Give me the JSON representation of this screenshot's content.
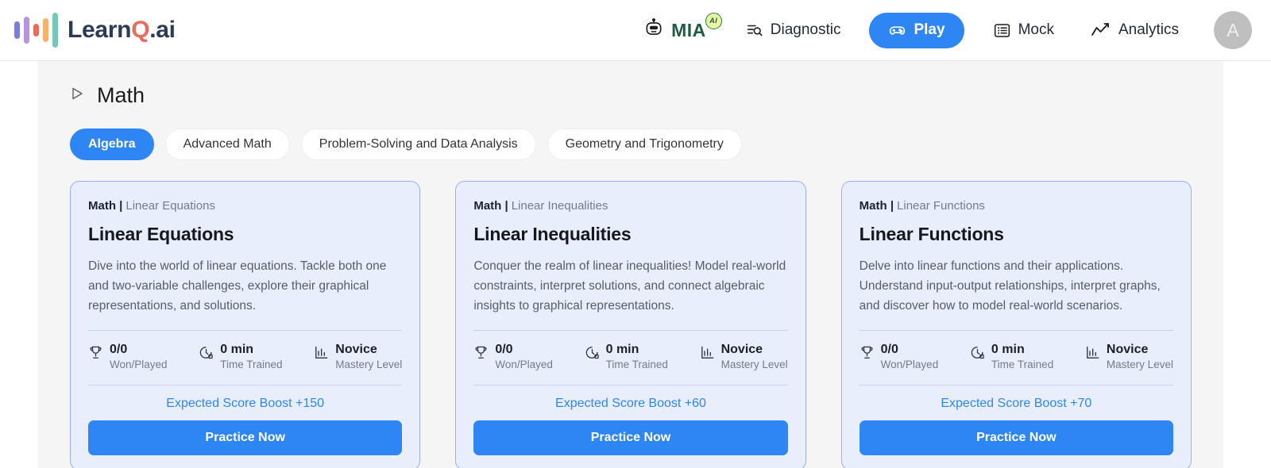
{
  "brand": {
    "name_prefix": "Learn",
    "name_q": "Q",
    "name_suffix": ".ai"
  },
  "nav": {
    "mia": {
      "label": "MIA",
      "badge": "AI",
      "icon": "robot-icon"
    },
    "items": [
      {
        "label": "Diagnostic",
        "icon": "search-list-icon",
        "active": false
      },
      {
        "label": "Play",
        "icon": "gamepad-icon",
        "active": true
      },
      {
        "label": "Mock",
        "icon": "list-icon",
        "active": false
      },
      {
        "label": "Analytics",
        "icon": "trendline-icon",
        "active": false
      }
    ],
    "avatar": {
      "initial": "A"
    }
  },
  "section": {
    "title": "Math",
    "expand_icon": "play-triangle-icon"
  },
  "tabs": [
    {
      "label": "Algebra",
      "active": true
    },
    {
      "label": "Advanced Math",
      "active": false
    },
    {
      "label": "Problem-Solving and Data Analysis",
      "active": false
    },
    {
      "label": "Geometry and Trigonometry",
      "active": false
    }
  ],
  "stat_labels": {
    "won_played": "Won/Played",
    "time_trained": "Time Trained",
    "mastery_level": "Mastery Level"
  },
  "cards": [
    {
      "subject": "Math |",
      "topic": "Linear Equations",
      "title": "Linear Equations",
      "description": "Dive into the world of linear equations. Tackle both one and two-variable challenges, explore their graphical representations, and solutions.",
      "won_played": "0/0",
      "time_trained": "0 min",
      "mastery_level": "Novice",
      "boost": "Expected Score Boost +150",
      "cta": "Practice Now"
    },
    {
      "subject": "Math |",
      "topic": "Linear Inequalities",
      "title": "Linear Inequalities",
      "description": "Conquer the realm of linear inequalities! Model real-world constraints, interpret solutions, and connect algebraic insights to graphical representations.",
      "won_played": "0/0",
      "time_trained": "0 min",
      "mastery_level": "Novice",
      "boost": "Expected Score Boost +60",
      "cta": "Practice Now"
    },
    {
      "subject": "Math |",
      "topic": "Linear Functions",
      "title": "Linear Functions",
      "description": "Delve into linear functions and their applications. Understand input-output relationships, interpret graphs, and discover how to model real-world scenarios.",
      "won_played": "0/0",
      "time_trained": "0 min",
      "mastery_level": "Novice",
      "boost": "Expected Score Boost +70",
      "cta": "Practice Now"
    }
  ],
  "colors": {
    "accent": "#2e86f5",
    "card_bg": "#e9eefc",
    "card_border": "#9aaff0",
    "panel_bg": "#f5f5f6",
    "mia_green": "#1f5c40",
    "badge_yellow": "#e8f5a3"
  }
}
